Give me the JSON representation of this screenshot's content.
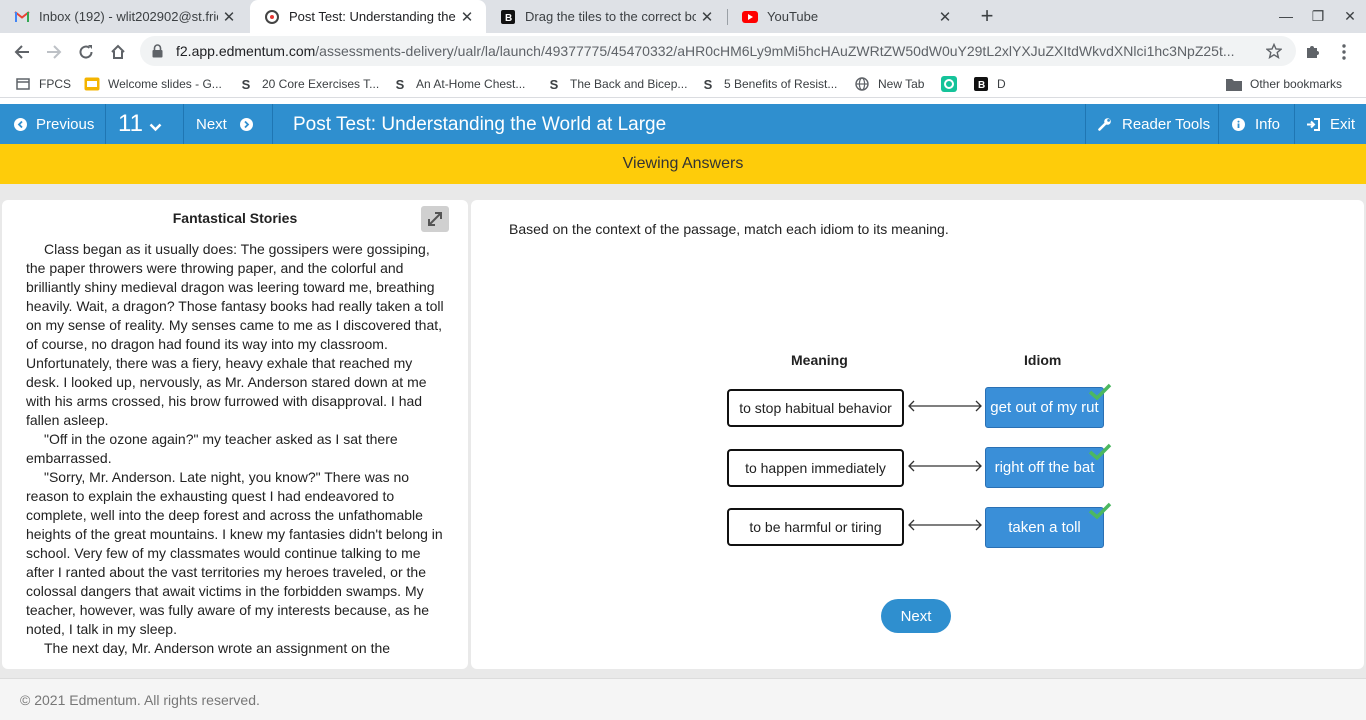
{
  "browser": {
    "tabs": [
      {
        "title": "Inbox (192) - wlit202902@st.frie",
        "icon": "gmail-icon",
        "active": false
      },
      {
        "title": "Post Test: Understanding the Wo",
        "icon": "edmentum-icon",
        "active": true
      },
      {
        "title": "Drag the tiles to the correct boxe",
        "icon": "brainly-icon",
        "active": false
      },
      {
        "title": "YouTube",
        "icon": "youtube-icon",
        "active": false
      }
    ],
    "url_host": "f2.app.edmentum.com",
    "url_path": "/assessments-delivery/ualr/la/launch/49377775/45470332/aHR0cHM6Ly9mMi5hcHAuZWRtZW50dW0uY29tL2xlYXJuZXItdWkvdXNlci1hc3NpZ25t...",
    "bookmarks": [
      {
        "label": "FPCS",
        "icon": "classlink-icon"
      },
      {
        "label": "Welcome slides - G...",
        "icon": "slides-icon"
      },
      {
        "label": "20 Core Exercises T...",
        "icon": "s-logo-icon"
      },
      {
        "label": "An At-Home Chest...",
        "icon": "s-logo-icon"
      },
      {
        "label": "The Back and Bicep...",
        "icon": "s-logo-icon"
      },
      {
        "label": "5 Benefits of Resist...",
        "icon": "s-logo-icon"
      },
      {
        "label": "New Tab",
        "icon": "globe-icon"
      },
      {
        "label": "",
        "icon": "grammarly-icon"
      },
      {
        "label": "D",
        "icon": "brainly-icon"
      }
    ],
    "other_bookmarks": "Other bookmarks"
  },
  "app": {
    "previous": "Previous",
    "question_number": "11",
    "next": "Next",
    "title": "Post Test: Understanding the World at Large",
    "reader_tools": "Reader Tools",
    "info": "Info",
    "exit": "Exit",
    "banner": "Viewing Answers"
  },
  "passage": {
    "title": "Fantastical Stories",
    "paragraphs": [
      "Class began as it usually does: The gossipers were gossiping, the paper throwers were throwing paper, and the colorful and brilliantly shiny medieval dragon was leering toward me, breathing heavily. Wait, a dragon? Those fantasy books had really taken a toll on my sense of reality. My senses came to me as I discovered that, of course, no dragon had found its way into my classroom. Unfortunately, there was a fiery, heavy exhale that reached my desk. I looked up, nervously, as Mr. Anderson stared down at me with his arms crossed, his brow furrowed with disapproval. I had fallen asleep.",
      "\"Off in the ozone again?\" my teacher asked as I sat there embarrassed.",
      "\"Sorry, Mr. Anderson. Late night, you know?\" There was no reason to explain the exhausting quest I had endeavored to complete, well into the deep forest and across the unfathomable heights of the great mountains. I knew my fantasies didn't belong in school. Very few of my classmates would continue talking to me after I ranted about the vast territories my heroes traveled, or the colossal dangers that await victims in the forbidden swamps. My teacher, however, was fully aware of my interests because, as he noted, I talk in my sleep.",
      "The next day, Mr. Anderson wrote an assignment on the"
    ]
  },
  "question": {
    "prompt": "Based on the context of the passage, match each idiom to its meaning.",
    "meaning_header": "Meaning",
    "idiom_header": "Idiom",
    "pairs": [
      {
        "meaning": "to stop habitual behavior",
        "idiom": "get out of my rut",
        "correct": true
      },
      {
        "meaning": "to happen immediately",
        "idiom": "right off the bat",
        "correct": true
      },
      {
        "meaning": "to be harmful or tiring",
        "idiom": "taken a toll",
        "correct": true
      }
    ],
    "next_button": "Next"
  },
  "footer": "© 2021 Edmentum. All rights reserved.",
  "colors": {
    "app_blue": "#2f8fcf",
    "banner_yellow": "#fecc0a",
    "check_green": "#4cb860"
  }
}
